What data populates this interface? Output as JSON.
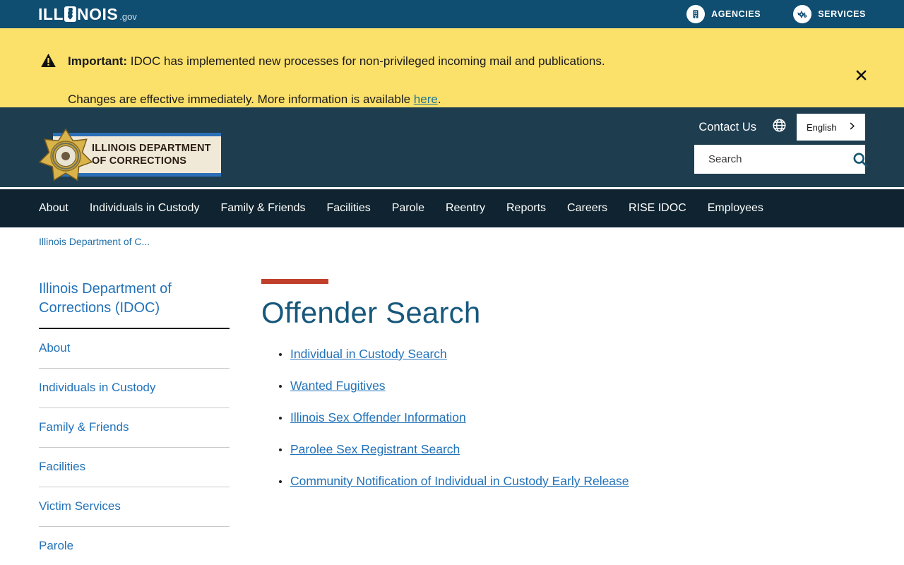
{
  "topbar": {
    "logo_prefix": "ILL",
    "logo_suffix": "NOIS",
    "logo_tld": ".gov",
    "agencies_label": "AGENCIES",
    "services_label": "SERVICES"
  },
  "alert": {
    "important_label": "Important:",
    "line1_rest": " IDOC has implemented new processes for non-privileged incoming mail and publications.",
    "line2_before_link": "Changes are effective immediately. More information is available ",
    "link_text": "here",
    "line2_after_link": "."
  },
  "header": {
    "logo_line1": "ILLINOIS DEPARTMENT",
    "logo_line2": "OF CORRECTIONS",
    "contact_us_label": "Contact Us",
    "language_selected": "English",
    "search_placeholder": "Search"
  },
  "nav": {
    "items": [
      "About",
      "Individuals in Custody",
      "Family & Friends",
      "Facilities",
      "Parole",
      "Reentry",
      "Reports",
      "Careers",
      "RISE IDOC",
      "Employees"
    ]
  },
  "breadcrumb": {
    "text": "Illinois Department of C..."
  },
  "sidebar": {
    "title": "Illinois Department of Corrections (IDOC)",
    "items": [
      "About",
      "Individuals in Custody",
      "Family & Friends",
      "Facilities",
      "Victim Services",
      "Parole"
    ]
  },
  "main": {
    "title": "Offender Search",
    "links": [
      "Individual in Custody Search",
      "Wanted Fugitives",
      "Illinois Sex Offender Information",
      "Parolee Sex Registrant Search",
      "Community Notification of Individual in Custody Early Release"
    ]
  },
  "colors": {
    "topbar_blue": "#0F4D71",
    "alert_yellow": "#FBE06A",
    "header_slate": "#1E3E50",
    "nav_dark": "#0F2430",
    "link_blue": "#2272B9",
    "heading_teal": "#17587C",
    "accent_red": "#C0402C",
    "alert_link_teal": "#1F768F",
    "logo_banner_cream": "#F0E9D8",
    "logo_banner_blue": "#2B6FB7"
  }
}
